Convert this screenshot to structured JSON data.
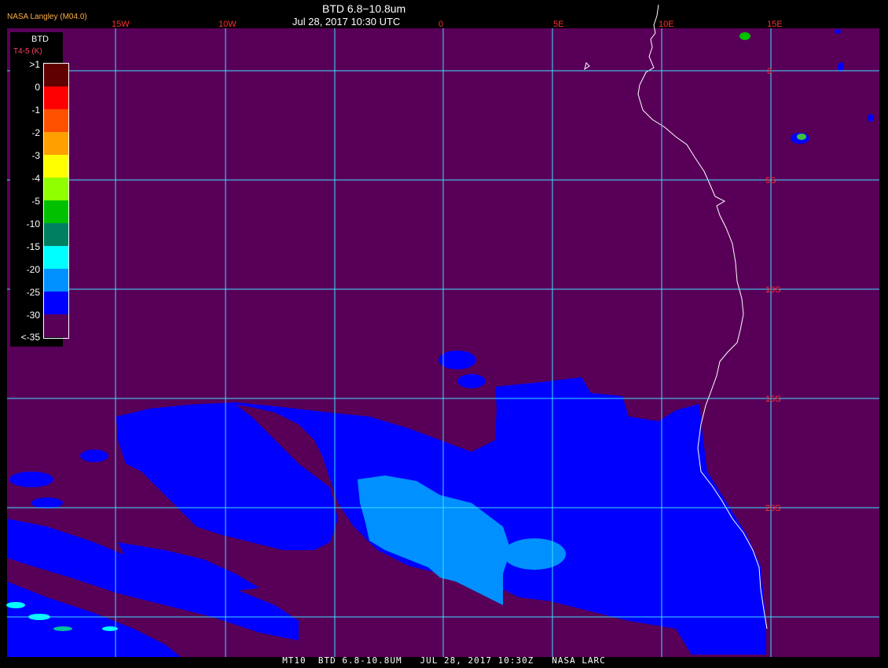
{
  "header": {
    "title": "BTD 6.8−10.8um",
    "timestamp": "Jul 28, 2017 10:30 UTC",
    "org": "NASA Langley (M04.0)"
  },
  "footer": {
    "text": "MT10  BTD 6.8-10.8UM   JUL 28, 2017 10:30Z   NASA LARC"
  },
  "legend": {
    "title": "BTD",
    "unit": "T4-5 (K)",
    "entries": [
      {
        "label": ">1",
        "color": "#600000"
      },
      {
        "label": "0",
        "color": "#ff0000"
      },
      {
        "label": "-1",
        "color": "#ff5000"
      },
      {
        "label": "-2",
        "color": "#ffa000"
      },
      {
        "label": "-3",
        "color": "#ffff00"
      },
      {
        "label": "-4",
        "color": "#90ff00"
      },
      {
        "label": "-5",
        "color": "#00c000"
      },
      {
        "label": "-10",
        "color": "#008060"
      },
      {
        "label": "-15",
        "color": "#00ffff"
      },
      {
        "label": "-20",
        "color": "#0090ff"
      },
      {
        "label": "-25",
        "color": "#0000ff"
      },
      {
        "label": "-30",
        "color": "#580058"
      },
      {
        "label": "<-35",
        "color": null
      }
    ]
  },
  "grid": {
    "longitudes": [
      "15W",
      "10W",
      "0",
      "5E",
      "10E",
      "15E"
    ],
    "latitudes": [
      "0",
      "5S",
      "10S",
      "15S",
      "20S"
    ]
  },
  "colors": {
    "background": "#580058",
    "gridline": "#40e0ff",
    "grid_label": "#ff3030",
    "coastline": "#ffffff",
    "cloud_deep": "#0000ff",
    "cloud_light": "#0090ff",
    "cloud_cyan": "#00ffff"
  }
}
